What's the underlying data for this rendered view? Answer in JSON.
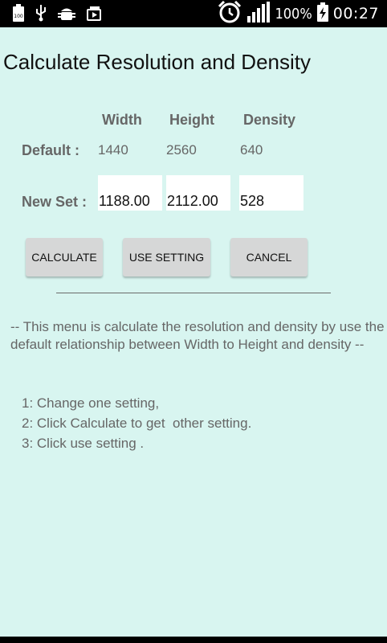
{
  "status_bar": {
    "battery_percent": "100%",
    "time": "00:27",
    "left_icons": [
      "battery-100-icon",
      "usb-icon",
      "android-debug-icon",
      "media-icon"
    ],
    "right_icons": [
      "alarm-icon",
      "signal-icon",
      "battery-charging-icon"
    ]
  },
  "page": {
    "title": "Calculate Resolution and Density"
  },
  "table": {
    "columns": [
      "Width",
      "Height",
      "Density"
    ],
    "default_label": "Default :",
    "default_values": [
      "1440",
      "2560",
      "640"
    ],
    "new_set_label": "New Set :",
    "new_set_values": [
      "1188.00",
      "2112.00",
      "528"
    ]
  },
  "buttons": {
    "calculate": "CALCULATE",
    "use_setting": "USE SETTING",
    "cancel": "CANCEL"
  },
  "info": {
    "description": "-- This menu is calculate the resolution and density by use the default relationship between Width to Height and density --",
    "steps": [
      "1: Change one setting,",
      "2: Click Calculate to get  other setting.",
      "3: Click use setting ."
    ]
  },
  "colors": {
    "background": "#d8f5f0",
    "status_bar": "#000000",
    "label_text": "#666666",
    "button_bg": "#d6d7d7"
  }
}
